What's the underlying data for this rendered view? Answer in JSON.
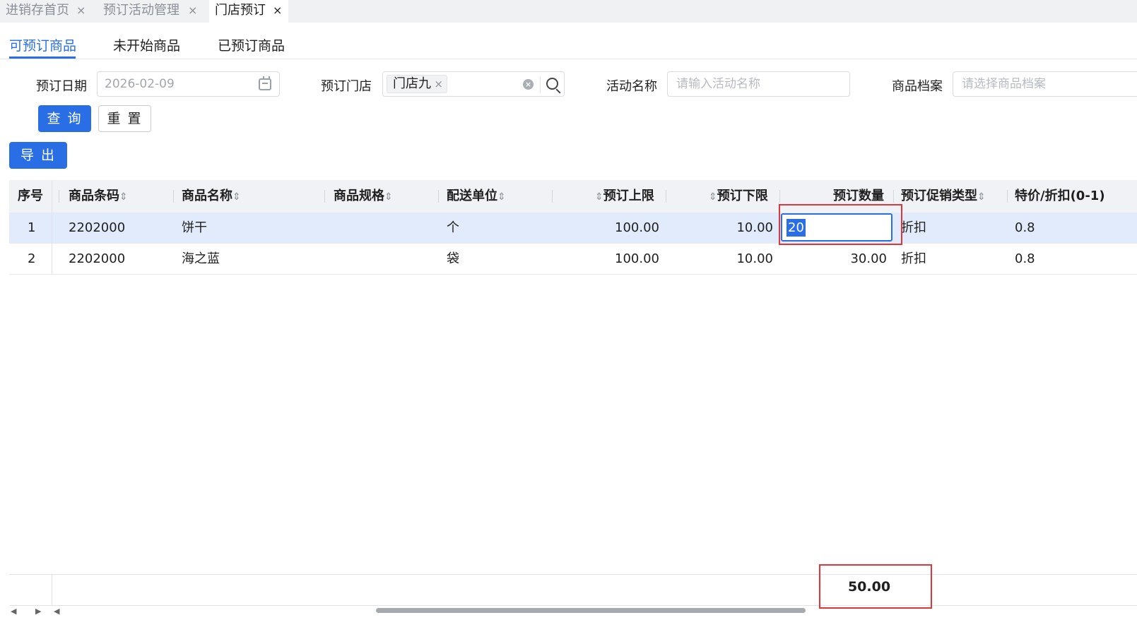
{
  "tabs": [
    {
      "label": "进销存首页",
      "close": "×"
    },
    {
      "label": "预订活动管理",
      "close": "×"
    },
    {
      "label": "门店预订",
      "close": "×"
    }
  ],
  "subtabs": [
    "可预订商品",
    "未开始商品",
    "已预订商品"
  ],
  "filters": {
    "date_label": "预订日期",
    "date_value": "2026-02-09",
    "store_label": "预订门店",
    "store_tag": "门店九",
    "store_tag_close": "×",
    "activity_label": "活动名称",
    "activity_placeholder": "请输入活动名称",
    "product_label": "商品档案",
    "product_placeholder": "请选择商品档案"
  },
  "buttons": {
    "query": "查 询",
    "reset": "重 置",
    "export": "导 出"
  },
  "table": {
    "columns": [
      "序号",
      "商品条码",
      "商品名称",
      "商品规格",
      "配送单位",
      "预订上限",
      "预订下限",
      "预订数量",
      "预订促销类型",
      "特价/折扣(0-1)"
    ],
    "sort_glyph": "⇕",
    "rows": [
      {
        "idx": "1",
        "barcode": "2202000",
        "name": "饼干",
        "spec": "",
        "unit": "个",
        "upper": "100.00",
        "lower": "10.00",
        "qty": "20",
        "promo": "折扣",
        "discount": "0.8"
      },
      {
        "idx": "2",
        "barcode": "2202000",
        "name": "海之蓝",
        "spec": "",
        "unit": "袋",
        "upper": "100.00",
        "lower": "10.00",
        "qty": "30.00",
        "promo": "折扣",
        "discount": "0.8"
      }
    ]
  },
  "summary": {
    "total_qty": "50.00"
  },
  "scroll": {
    "left_arrow": "◀",
    "right_arrow": "▶"
  },
  "colors": {
    "accent": "#2a6ee6",
    "highlight": "#e0363b",
    "selected_row": "#e2ebfb"
  }
}
